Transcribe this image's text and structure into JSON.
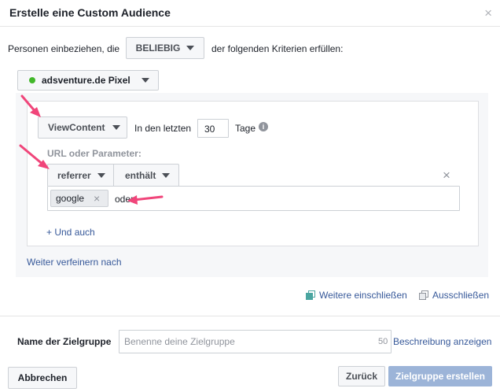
{
  "dialog": {
    "title": "Erstelle eine Custom Audience",
    "close": "×"
  },
  "include_row": {
    "prefix": "Personen einbeziehen, die",
    "mode": "BELIEBIG",
    "suffix": "der folgenden Kriterien erfüllen:"
  },
  "pixel": {
    "name": "adsventure.de Pixel",
    "status_color": "#42b72a"
  },
  "rule": {
    "event": "ViewContent",
    "period_prefix": "In den letzten",
    "days": "30",
    "period_suffix": "Tage",
    "info_icon": "i",
    "url_label": "URL oder Parameter:",
    "param": "referrer",
    "operator": "enthält",
    "remove": "×",
    "token": "google",
    "token_remove": "×",
    "typed_text": "oder",
    "add_link": "+ Und auch"
  },
  "refine_link": "Weiter verfeinern nach",
  "actions": {
    "include_more": "Weitere einschließen",
    "exclude": "Ausschließen"
  },
  "audience_name": {
    "label": "Name der Zielgruppe",
    "placeholder": "Benenne deine Zielgruppe",
    "char_count": "50",
    "description_link": "Beschreibung anzeigen"
  },
  "footer": {
    "cancel": "Abbrechen",
    "back": "Zurück",
    "create": "Zielgruppe erstellen"
  },
  "colors": {
    "link": "#365899",
    "annotation_arrow": "#f0457a",
    "primary_disabled": "#9cb4d8"
  }
}
